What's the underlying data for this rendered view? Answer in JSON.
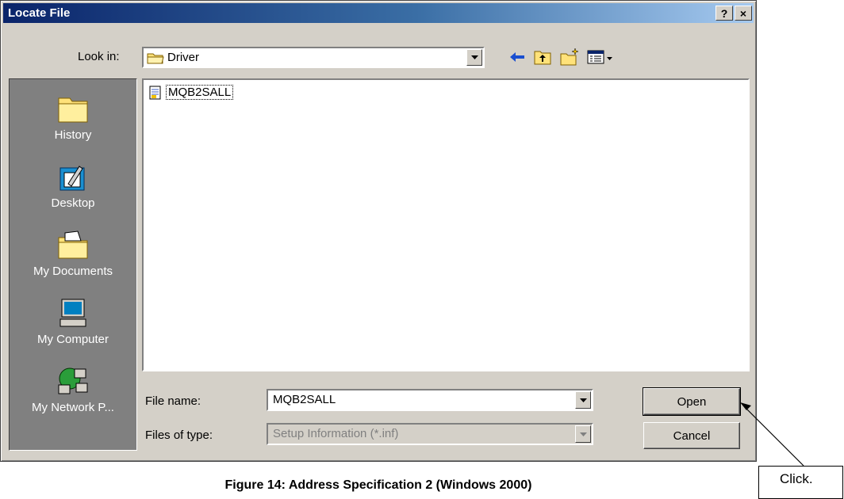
{
  "window": {
    "title": "Locate File"
  },
  "title_buttons": {
    "help": "?",
    "close": "×"
  },
  "look_in": {
    "label": "Look in:",
    "value": "Driver"
  },
  "places": [
    {
      "label": "History"
    },
    {
      "label": "Desktop"
    },
    {
      "label": "My Documents"
    },
    {
      "label": "My Computer"
    },
    {
      "label": "My Network P..."
    }
  ],
  "files": [
    {
      "name": "MQB2SALL"
    }
  ],
  "file_name": {
    "label": "File name:",
    "value": "MQB2SALL"
  },
  "file_type": {
    "label": "Files of type:",
    "value": "Setup Information (*.inf)"
  },
  "buttons": {
    "open": "Open",
    "cancel": "Cancel"
  },
  "caption": "Figure 14: Address Specification 2 (Windows 2000)",
  "callout": "Click.",
  "colors": {
    "titlebar": "#0a246a",
    "face": "#d4d0c8",
    "places_bg": "#808080"
  },
  "icons": [
    "folder-icon",
    "back-arrow-icon",
    "up-folder-icon",
    "new-folder-icon",
    "view-menu-icon",
    "history-icon",
    "desktop-icon",
    "my-documents-icon",
    "my-computer-icon",
    "network-icon",
    "inf-file-icon"
  ]
}
